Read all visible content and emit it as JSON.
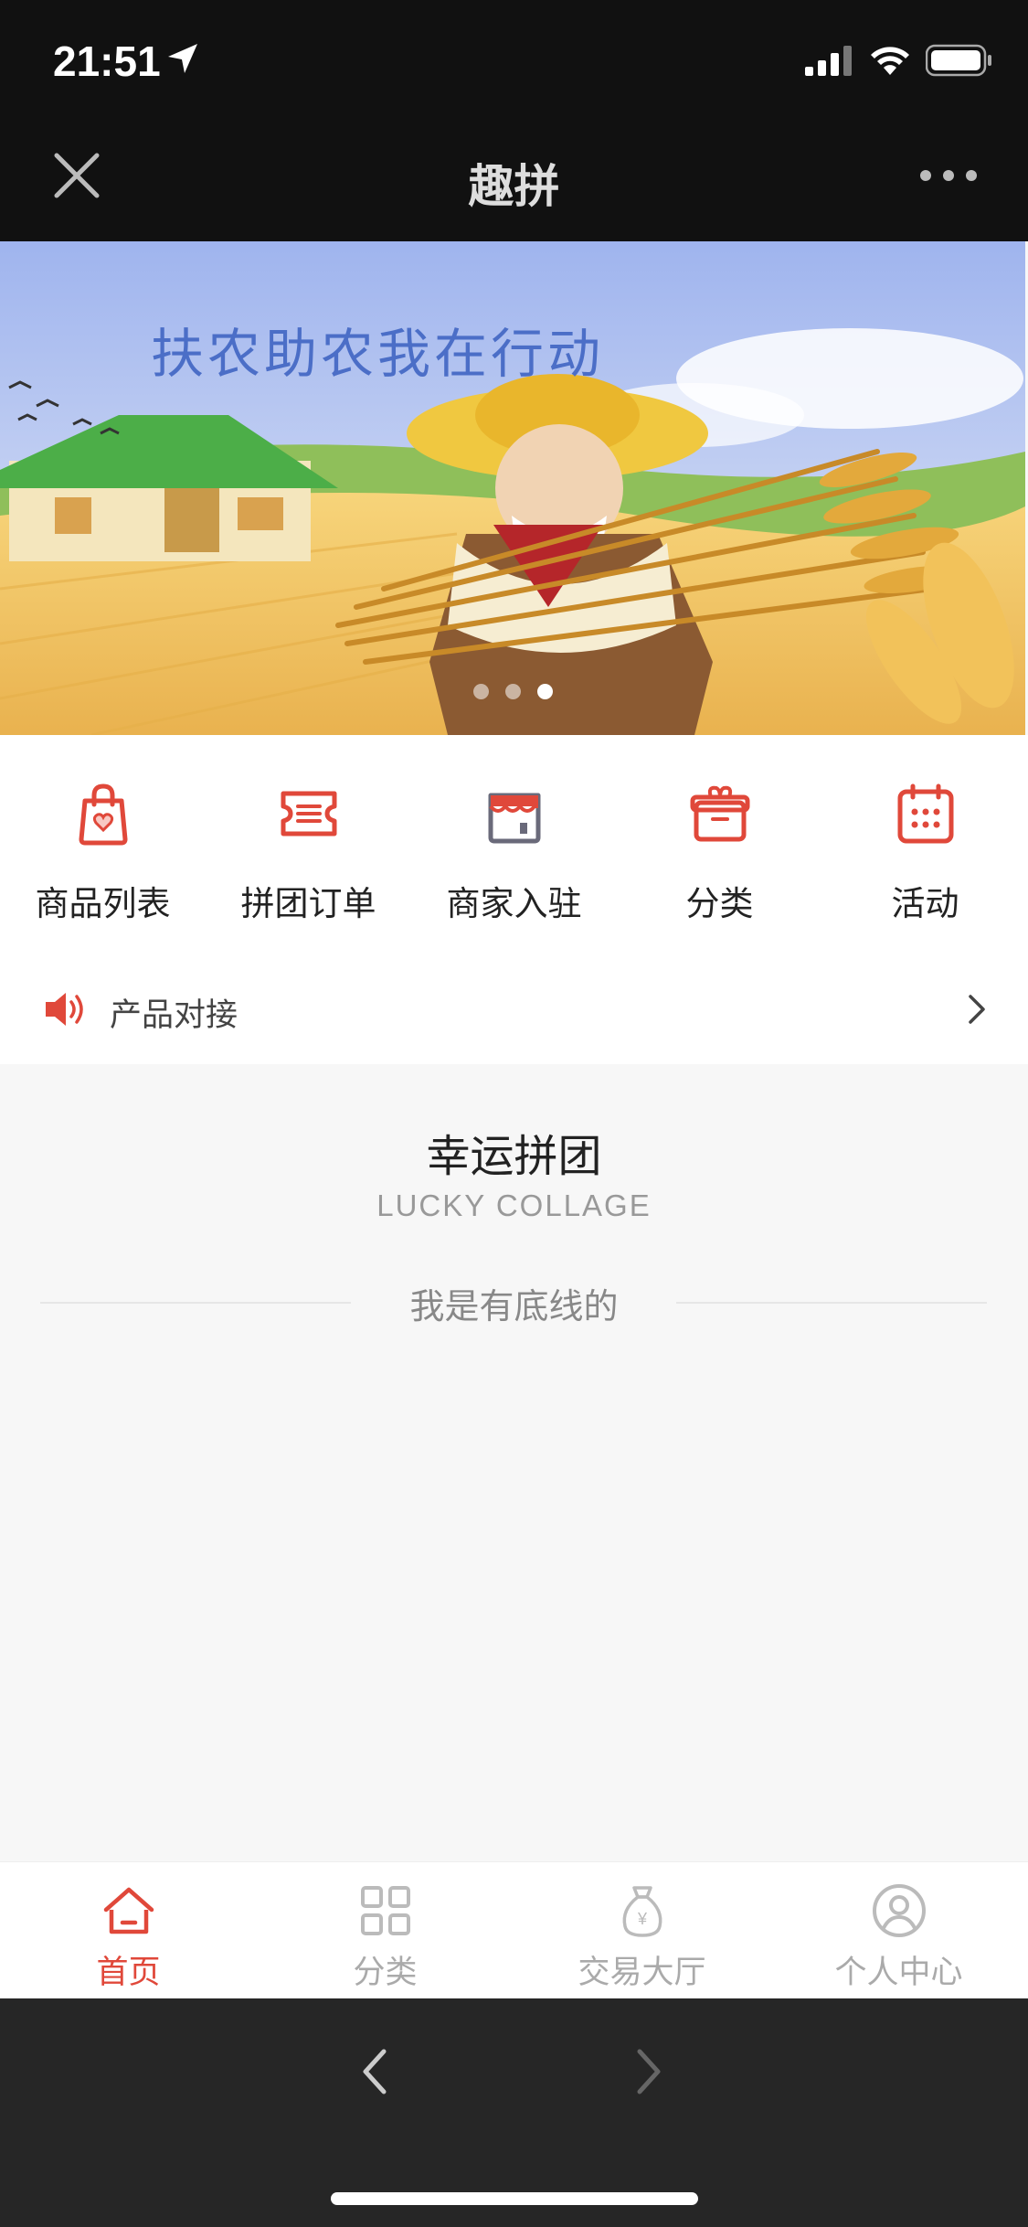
{
  "status_bar": {
    "time": "21:51"
  },
  "nav": {
    "title": "趣拼"
  },
  "banner": {
    "headline": "扶农助农我在行动",
    "slide_count": 3,
    "active_slide": 3
  },
  "menu": {
    "items": [
      {
        "label": "商品列表",
        "icon": "shopping-bag-icon"
      },
      {
        "label": "拼团订单",
        "icon": "ticket-icon"
      },
      {
        "label": "商家入驻",
        "icon": "storefront-icon"
      },
      {
        "label": "分类",
        "icon": "gift-box-icon"
      },
      {
        "label": "活动",
        "icon": "calendar-icon"
      }
    ]
  },
  "notice": {
    "text": "产品对接"
  },
  "section": {
    "title": "幸运拼团",
    "subtitle": "LUCKY COLLAGE",
    "bottom_line": "我是有底线的"
  },
  "tabbar": {
    "active_index": 0,
    "items": [
      {
        "label": "首页",
        "icon": "home-icon"
      },
      {
        "label": "分类",
        "icon": "grid-icon"
      },
      {
        "label": "交易大厅",
        "icon": "money-bag-icon"
      },
      {
        "label": "个人中心",
        "icon": "user-profile-icon"
      }
    ]
  },
  "colors": {
    "accent": "#e0483a",
    "inactive": "#aaaaaa",
    "dark_bar": "#111111"
  }
}
